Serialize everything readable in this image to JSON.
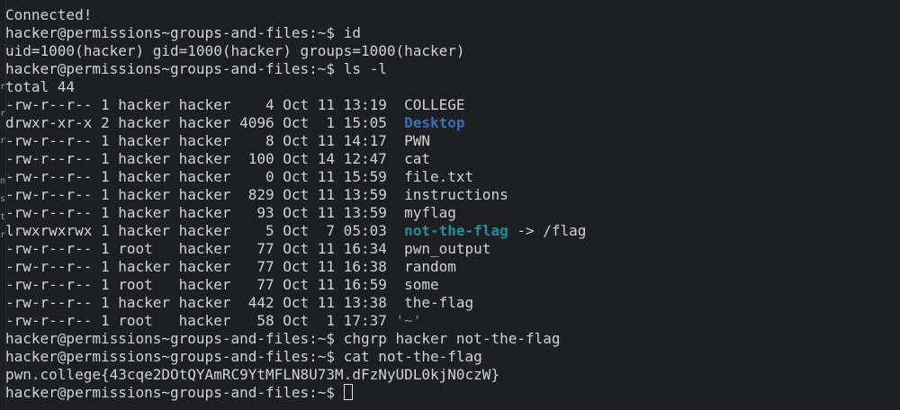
{
  "terminal": {
    "status": "Connected!",
    "prompt": "hacker@permissions~groups-and-files:~$ ",
    "cmd_id": "id",
    "id_output": "uid=1000(hacker) gid=1000(hacker) groups=1000(hacker)",
    "cmd_ls": "ls -l",
    "total": "total 44",
    "files": [
      {
        "meta": "-rw-r--r-- 1 hacker hacker    4 Oct 11 13:19  ",
        "name": "COLLEGE"
      },
      {
        "meta": "drwxr-xr-x 2 hacker hacker 4096 Oct  1 15:05  ",
        "name": "Desktop"
      },
      {
        "meta": "-rw-r--r-- 1 hacker hacker    8 Oct 11 14:17  ",
        "name": "PWN"
      },
      {
        "meta": "-rw-r--r-- 1 hacker hacker  100 Oct 14 12:47  ",
        "name": "cat"
      },
      {
        "meta": "-rw-r--r-- 1 hacker hacker    0 Oct 11 15:59  ",
        "name": "file.txt"
      },
      {
        "meta": "-rw-r--r-- 1 hacker hacker  829 Oct 11 13:59  ",
        "name": "instructions"
      },
      {
        "meta": "-rw-r--r-- 1 hacker hacker   93 Oct 11 13:59  ",
        "name": "myflag"
      },
      {
        "meta": "lrwxrwxrwx 1 hacker hacker    5 Oct  7 05:03  ",
        "name": "not-the-flag",
        "link": " -> /flag"
      },
      {
        "meta": "-rw-r--r-- 1 root   hacker   77 Oct 11 16:34  ",
        "name": "pwn_output"
      },
      {
        "meta": "-rw-r--r-- 1 hacker hacker   77 Oct 11 16:38  ",
        "name": "random"
      },
      {
        "meta": "-rw-r--r-- 1 root   hacker   77 Oct 11 16:59  ",
        "name": "some"
      },
      {
        "meta": "-rw-r--r-- 1 hacker hacker  442 Oct 11 13:38  ",
        "name": "the-flag"
      },
      {
        "meta": "-rw-r--r-- 1 root   hacker   58 Oct  1 17:37 ",
        "name": "'~'"
      }
    ],
    "cmd_chgrp": "chgrp hacker not-the-flag",
    "cmd_cat": "cat not-the-flag",
    "flag": "pwn.college{43cqe2DOtQYAmRC9YtMFLN8U73M.dFzNyUDL0kjN0czW}",
    "edge_fragments": [
      "r",
      "r",
      "r",
      "n",
      "s",
      "t",
      "r"
    ]
  },
  "colors": {
    "background": "#1e1f22",
    "text": "#d3d3d3",
    "directory": "#3d6fb3",
    "symlink": "#1f8f9a"
  }
}
